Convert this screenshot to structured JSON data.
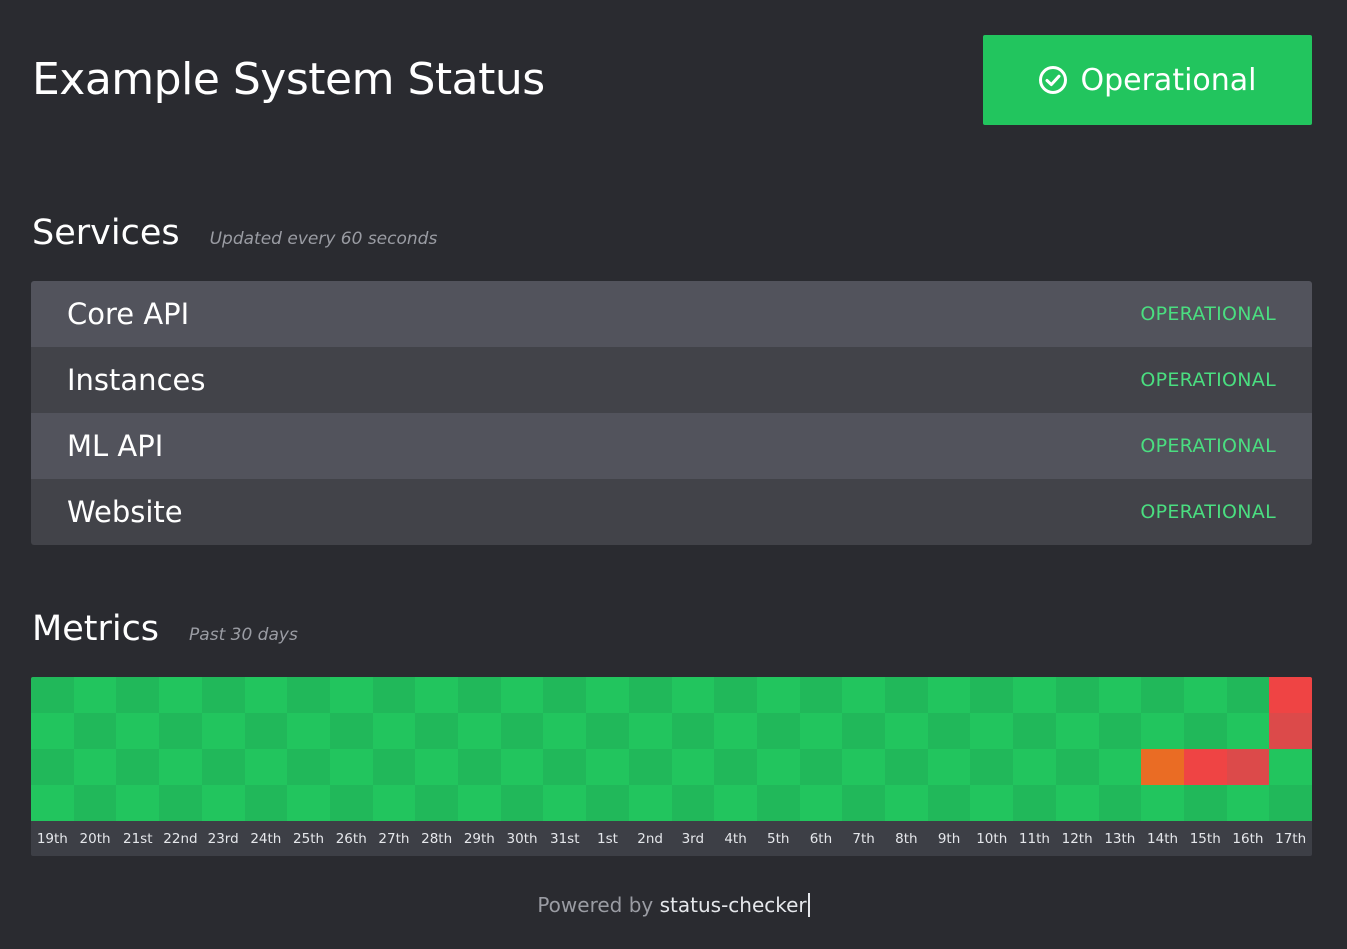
{
  "header": {
    "title": "Example System Status",
    "overall_status": "Operational",
    "status_icon": "check-circle-icon",
    "status_color": "#22c55e"
  },
  "services": {
    "title": "Services",
    "subtitle": "Updated every 60 seconds",
    "items": [
      {
        "name": "Core API",
        "status": "OPERATIONAL"
      },
      {
        "name": "Instances",
        "status": "OPERATIONAL"
      },
      {
        "name": "ML API",
        "status": "OPERATIONAL"
      },
      {
        "name": "Website",
        "status": "OPERATIONAL"
      }
    ],
    "status_color": "#4ade80"
  },
  "metrics": {
    "title": "Metrics",
    "subtitle": "Past 30 days",
    "days": [
      "19th",
      "20th",
      "21st",
      "22nd",
      "23rd",
      "24th",
      "25th",
      "26th",
      "27th",
      "28th",
      "29th",
      "30th",
      "31st",
      "1st",
      "2nd",
      "3rd",
      "4th",
      "5th",
      "6th",
      "7th",
      "8th",
      "9th",
      "10th",
      "11th",
      "12th",
      "13th",
      "14th",
      "15th",
      "16th",
      "17th"
    ],
    "colors": {
      "ok": "#22c55e",
      "ok_alt": "#21b85a",
      "degraded": "#ea6c24",
      "down": "#ef4444",
      "down_alt": "#dc4a4a"
    },
    "rows": [
      [
        "ok",
        "ok",
        "ok",
        "ok",
        "ok",
        "ok",
        "ok",
        "ok",
        "ok",
        "ok",
        "ok",
        "ok",
        "ok",
        "ok",
        "ok",
        "ok",
        "ok",
        "ok",
        "ok",
        "ok",
        "ok",
        "ok",
        "ok",
        "ok",
        "ok",
        "ok",
        "ok",
        "ok",
        "ok",
        "down"
      ],
      [
        "ok",
        "ok",
        "ok",
        "ok",
        "ok",
        "ok",
        "ok",
        "ok",
        "ok",
        "ok",
        "ok",
        "ok",
        "ok",
        "ok",
        "ok",
        "ok",
        "ok",
        "ok",
        "ok",
        "ok",
        "ok",
        "ok",
        "ok",
        "ok",
        "ok",
        "ok",
        "ok",
        "ok",
        "ok",
        "down"
      ],
      [
        "ok",
        "ok",
        "ok",
        "ok",
        "ok",
        "ok",
        "ok",
        "ok",
        "ok",
        "ok",
        "ok",
        "ok",
        "ok",
        "ok",
        "ok",
        "ok",
        "ok",
        "ok",
        "ok",
        "ok",
        "ok",
        "ok",
        "ok",
        "ok",
        "ok",
        "ok",
        "degraded",
        "down",
        "down",
        "ok"
      ],
      [
        "ok",
        "ok",
        "ok",
        "ok",
        "ok",
        "ok",
        "ok",
        "ok",
        "ok",
        "ok",
        "ok",
        "ok",
        "ok",
        "ok",
        "ok",
        "ok",
        "ok",
        "ok",
        "ok",
        "ok",
        "ok",
        "ok",
        "ok",
        "ok",
        "ok",
        "ok",
        "ok",
        "ok",
        "ok",
        "ok"
      ]
    ]
  },
  "footer": {
    "prefix": "Powered by ",
    "link": "status-checker"
  }
}
